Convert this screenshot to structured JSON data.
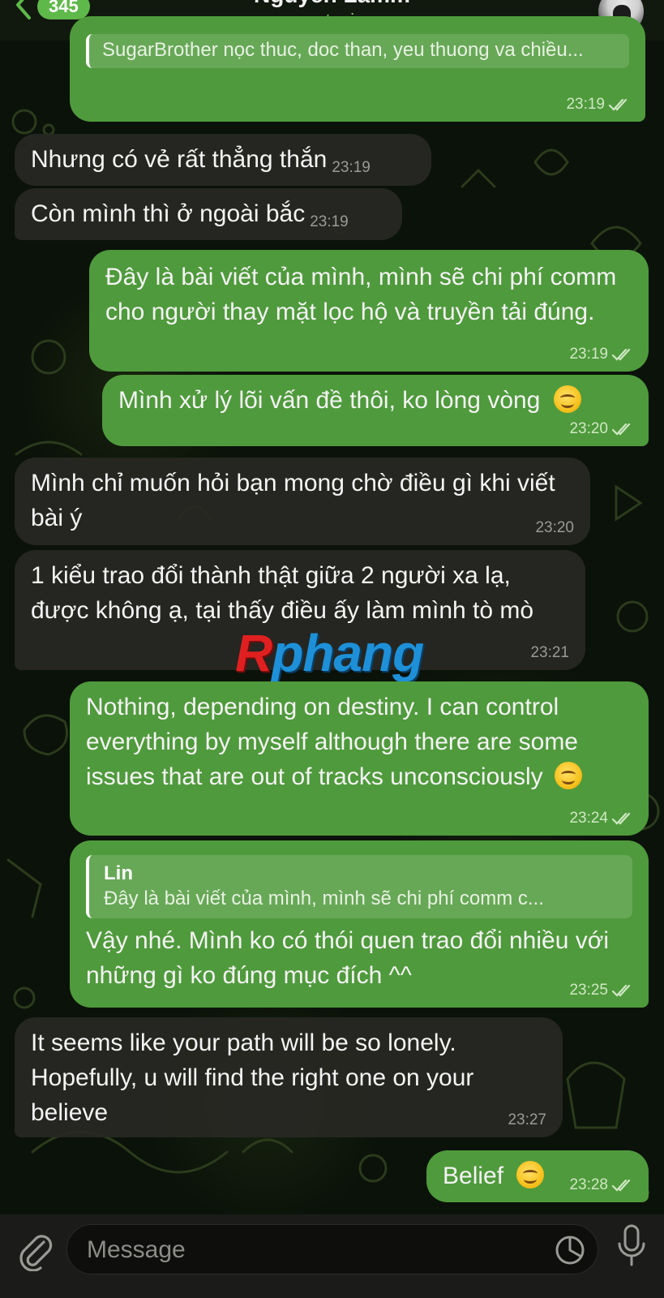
{
  "header": {
    "back_count": "345",
    "contact_name": "Nguyen Lamm",
    "status_text": "typing"
  },
  "messages": [
    {
      "id": "m0",
      "dir": "out",
      "text": "SugarBrother nọc thuc, doc than, yeu thuong va chiều...",
      "time": "23:19",
      "read": true
    },
    {
      "id": "m1",
      "dir": "in",
      "text": "Nhưng có vẻ rất thẳng thắn",
      "time": "23:19"
    },
    {
      "id": "m2",
      "dir": "in",
      "text": "Còn mình thì ở ngoài bắc",
      "time": "23:19"
    },
    {
      "id": "m3",
      "dir": "out",
      "text": "Đây là bài viết của mình, mình sẽ chi phí comm cho người thay mặt lọc hộ và truyền tải đúng.",
      "time": "23:19",
      "read": true
    },
    {
      "id": "m4",
      "dir": "out",
      "text": "Mình xử lý lõi vấn đề thôi, ko lòng vòng",
      "emoji": "smiling-face",
      "time": "23:20",
      "read": true
    },
    {
      "id": "m5",
      "dir": "in",
      "text": "Mình chỉ muốn hỏi bạn mong chờ điều gì khi viết bài ý",
      "time": "23:20"
    },
    {
      "id": "m6",
      "dir": "in",
      "text": "1 kiểu trao đổi thành thật giữa 2 người xa lạ, được không ạ, tại thấy điều ấy làm mình tò mò",
      "time": "23:21"
    },
    {
      "id": "m7",
      "dir": "out",
      "text": "Nothing, depending on destiny. I can control everything by myself although there are some issues that are out of tracks unconsciously",
      "emoji": "smiling-face",
      "time": "23:24",
      "read": true
    },
    {
      "id": "m8",
      "dir": "out",
      "reply_author": "Lin",
      "reply_text": "Đây là bài viết của mình, mình sẽ chi phí comm c...",
      "text": "Vậy nhé. Mình ko có thói quen trao đổi nhiều với những gì ko đúng mục đích ^^",
      "time": "23:25",
      "read": true
    },
    {
      "id": "m9",
      "dir": "in",
      "text": "It seems like your path will be so lonely. Hopefully, u will find the right one on your believe",
      "time": "23:27"
    },
    {
      "id": "m10",
      "dir": "out",
      "text": "Belief",
      "emoji": "relieved-face",
      "time": "23:28",
      "read": true
    }
  ],
  "watermark": {
    "first": "R",
    "rest": "phang"
  },
  "composer": {
    "placeholder": "Message",
    "value": ""
  },
  "colors": {
    "outgoing_bubble": "#4f9a3c",
    "incoming_bubble": "#2a2a26",
    "accent": "#5fb84a"
  }
}
